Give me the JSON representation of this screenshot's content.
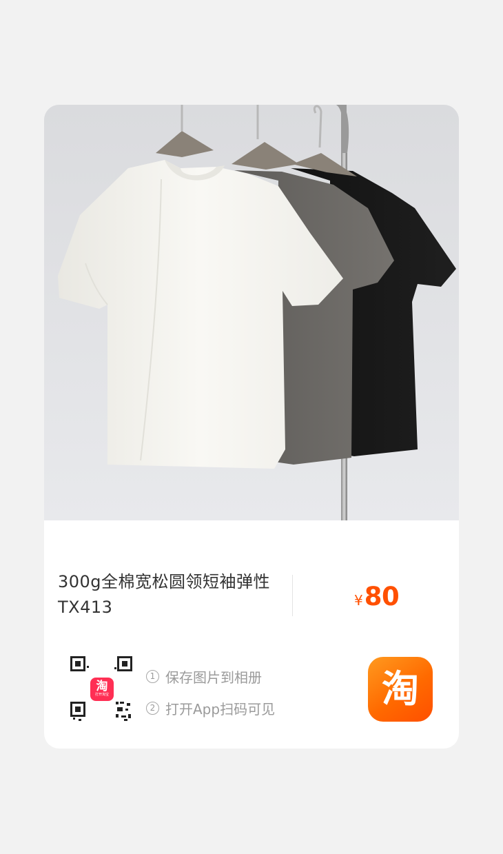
{
  "product": {
    "title": "300g全棉宽松圆领短袖弹性 TX413",
    "image_alt": "Three t-shirts (white, grey, black) hanging on a clothes rack"
  },
  "price": {
    "currency_symbol": "¥",
    "value": "80"
  },
  "qr": {
    "logo_char": "淘",
    "logo_sub": "打开淘宝"
  },
  "steps": [
    {
      "num": "1",
      "text": "保存图片到相册"
    },
    {
      "num": "2",
      "text": "打开App扫码可见"
    }
  ],
  "app_icon": {
    "char": "淘"
  },
  "colors": {
    "price": "#ff5000",
    "app_icon": "#ff6a00",
    "page_bg": "#f2f2f2"
  }
}
